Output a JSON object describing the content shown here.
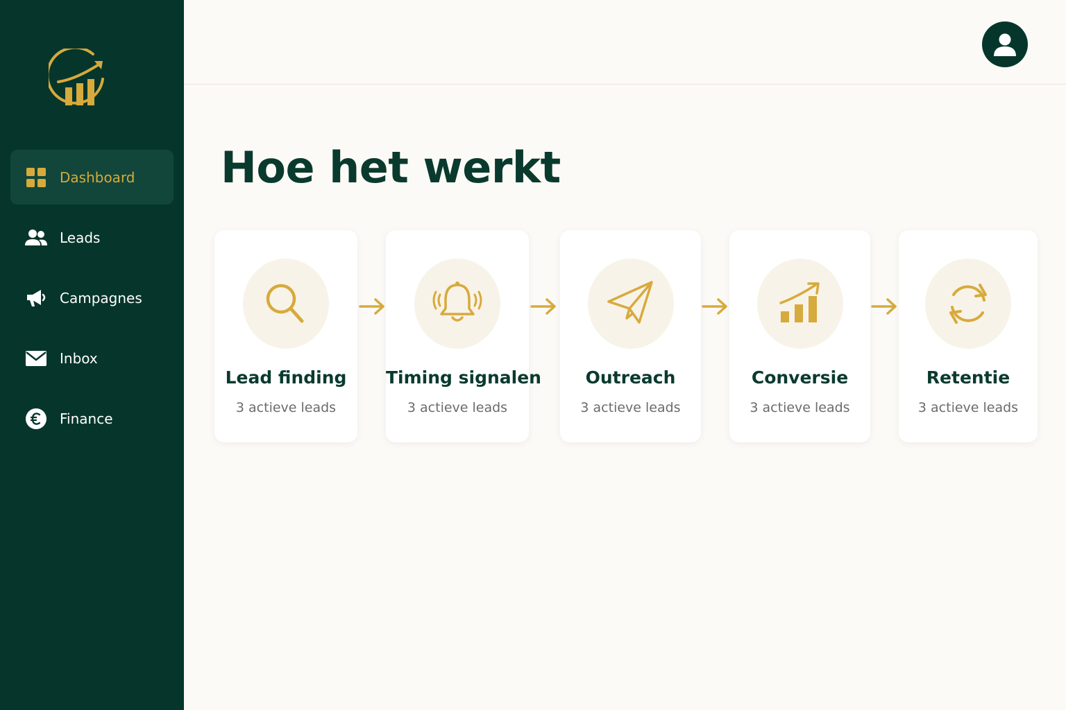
{
  "sidebar": {
    "items": [
      {
        "label": "Dashboard",
        "icon": "grid-icon",
        "active": true
      },
      {
        "label": "Leads",
        "icon": "users-icon",
        "active": false
      },
      {
        "label": "Campagnes",
        "icon": "megaphone-icon",
        "active": false
      },
      {
        "label": "Inbox",
        "icon": "envelope-icon",
        "active": false
      },
      {
        "label": "Finance",
        "icon": "euro-icon",
        "active": false
      }
    ]
  },
  "header": {
    "avatar_icon": "user-icon"
  },
  "main": {
    "title": "Hoe het werkt",
    "steps": [
      {
        "name": "Lead finding",
        "sub": "3 actieve leads",
        "icon": "search-icon"
      },
      {
        "name": "Timing signalen",
        "sub": "3 actieve leads",
        "icon": "bell-icon"
      },
      {
        "name": "Outreach",
        "sub": "3 actieve leads",
        "icon": "paper-plane-icon"
      },
      {
        "name": "Conversie",
        "sub": "3 actieve leads",
        "icon": "growth-chart-icon"
      },
      {
        "name": "Retentie",
        "sub": "3 actieve leads",
        "icon": "refresh-icon"
      }
    ]
  },
  "colors": {
    "sidebar": "#06362B",
    "accent": "#D7AA3C",
    "title": "#0A3A2E",
    "background": "#FCFAF6"
  }
}
